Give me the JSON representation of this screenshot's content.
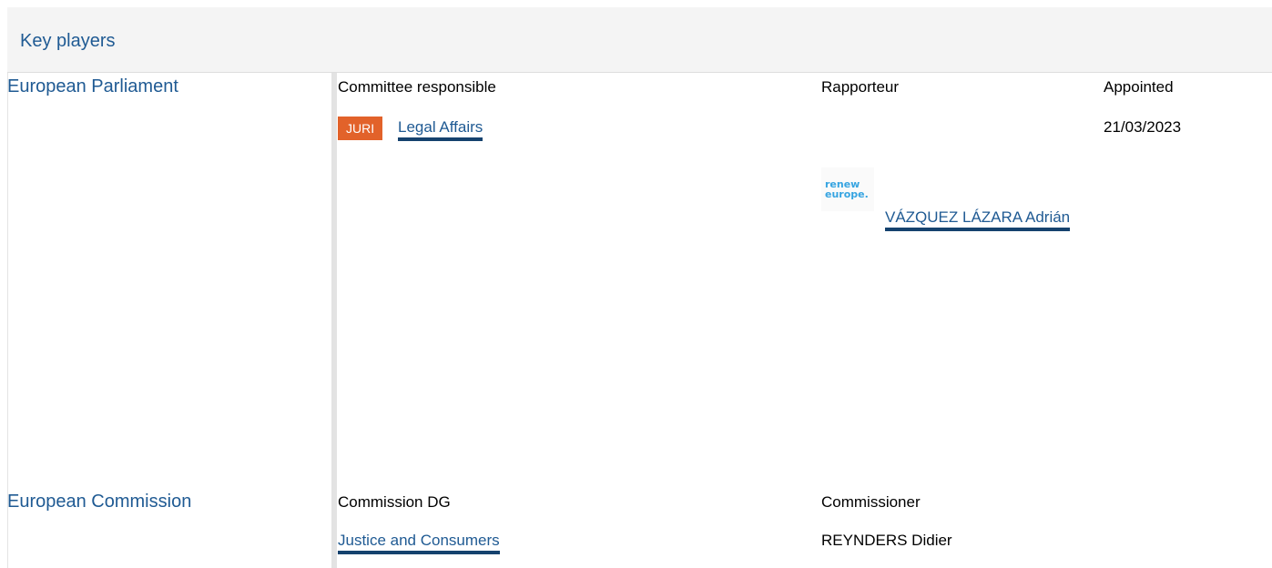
{
  "section": {
    "title": "Key players"
  },
  "european_parliament": {
    "institution": "European Parliament",
    "committee_label": "Committee responsible",
    "rapporteur_label": "Rapporteur",
    "appointed_label": "Appointed",
    "committee_code": "JURI",
    "committee_name": "Legal Affairs",
    "group_logo": {
      "line1": "renew",
      "line2": "europe."
    },
    "rapporteur_name": "VÁZQUEZ LÁZARA Adrián",
    "appointed_date": "21/03/2023"
  },
  "european_commission": {
    "institution": "European Commission",
    "dg_label": "Commission DG",
    "commissioner_label": "Commissioner",
    "dg_name": "Justice and Consumers",
    "commissioner_name": "REYNDERS Didier"
  },
  "colors": {
    "institution_text": "#1f5a93",
    "link_underline": "#15426e",
    "badge_bg": "#e2622a",
    "header_bg": "#f4f4f4",
    "logo_text": "#36a4e1"
  }
}
